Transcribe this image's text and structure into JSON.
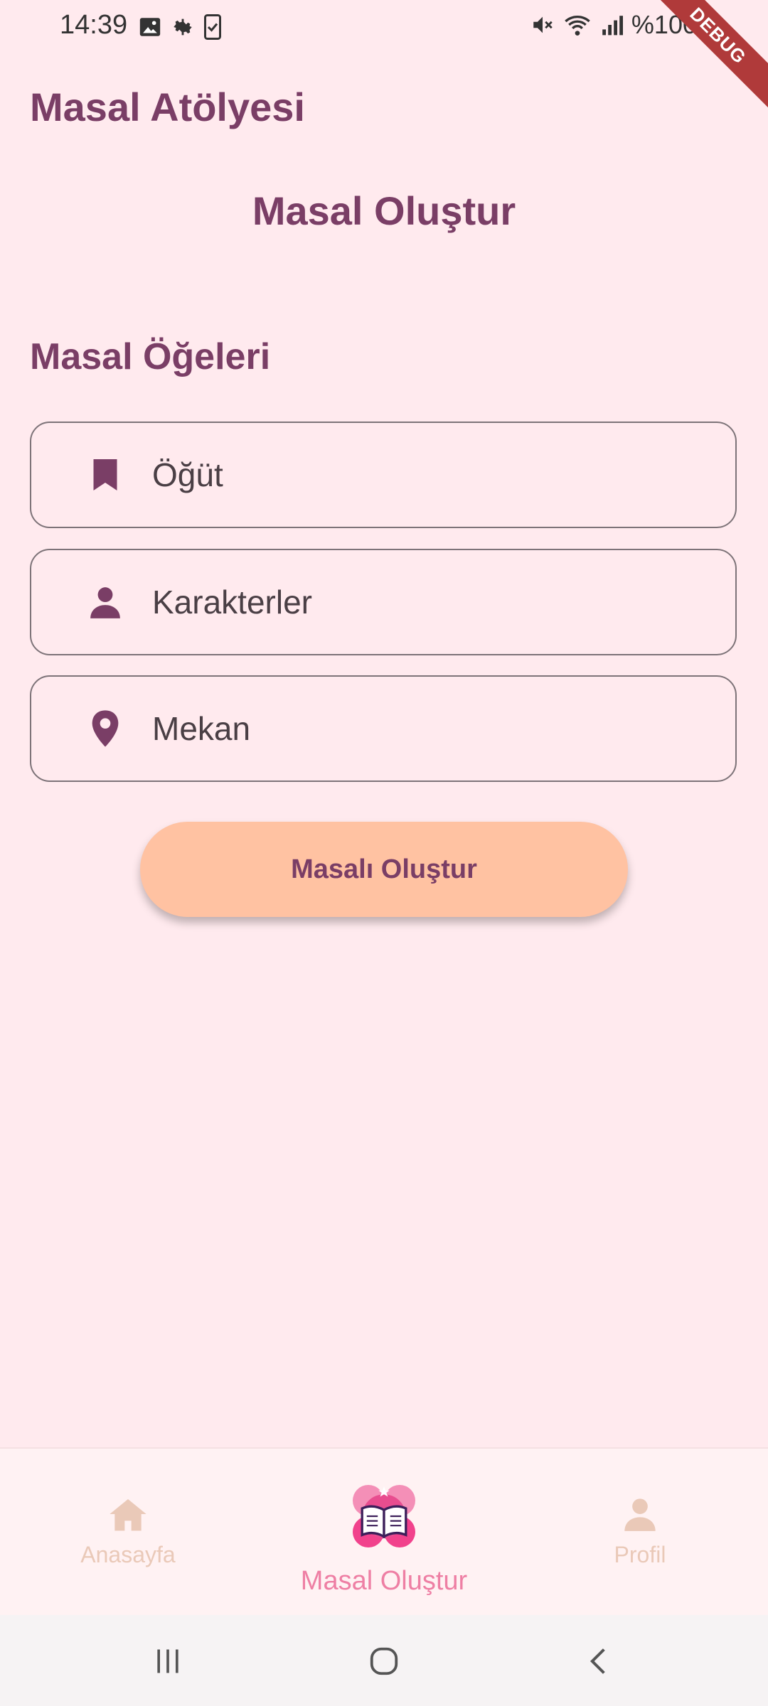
{
  "status_bar": {
    "time": "14:39",
    "battery_text": "%100",
    "debug_label": "DEBUG",
    "icons": [
      "image-icon",
      "gear-icon",
      "clipboard-phone-icon",
      "mute-icon",
      "wifi-icon",
      "signal-icon",
      "battery-icon"
    ]
  },
  "app": {
    "title": "Masal Atölyesi",
    "page_title": "Masal Oluştur",
    "section_title": "Masal Öğeleri"
  },
  "fields": [
    {
      "label": "Öğüt",
      "icon": "bookmark-icon"
    },
    {
      "label": "Karakterler",
      "icon": "person-icon"
    },
    {
      "label": "Mekan",
      "icon": "location-pin-icon"
    }
  ],
  "create_button": {
    "label": "Masalı Oluştur"
  },
  "bottom_nav": {
    "items": [
      {
        "label": "Anasayfa",
        "icon": "home-icon"
      },
      {
        "label": "Masal Oluştur",
        "icon": "story-book-icon",
        "active": true
      },
      {
        "label": "Profil",
        "icon": "person-icon"
      }
    ]
  },
  "colors": {
    "background": "#FFEAEE",
    "primary": "#7A3E66",
    "button": "#FFC2A2",
    "active_nav": "#EE7FA4",
    "inactive_nav": "#EAC9B8"
  }
}
